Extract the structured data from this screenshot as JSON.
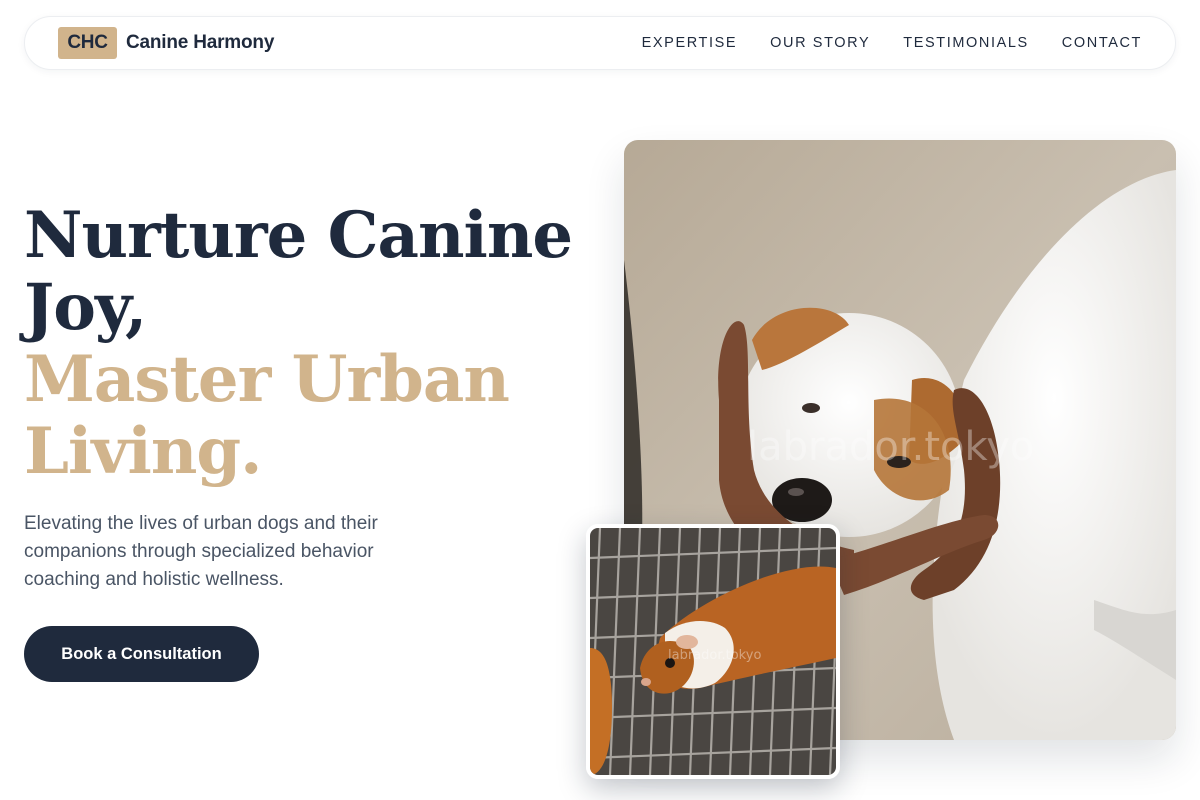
{
  "brand": {
    "logo_text": "CHC",
    "name": "Canine Harmony"
  },
  "nav": {
    "links": [
      {
        "label": "EXPERTISE"
      },
      {
        "label": "OUR STORY"
      },
      {
        "label": "TESTIMONIALS"
      },
      {
        "label": "CONTACT"
      }
    ]
  },
  "hero": {
    "title_line1": "Nurture Canine",
    "title_line2": "Joy,",
    "title_accent1": "Master Urban",
    "title_accent2": "Living.",
    "subtitle": "Elevating the lives of urban dogs and their companions through specialized behavior coaching and holistic wellness.",
    "cta_label": "Book a Consultation"
  },
  "images": {
    "main_watermark": "labrador.tokyo",
    "small_watermark": "labrador.tokyo"
  },
  "colors": {
    "navy": "#1f2a3d",
    "accent": "#d1b48c",
    "body_text": "#4a5565"
  }
}
